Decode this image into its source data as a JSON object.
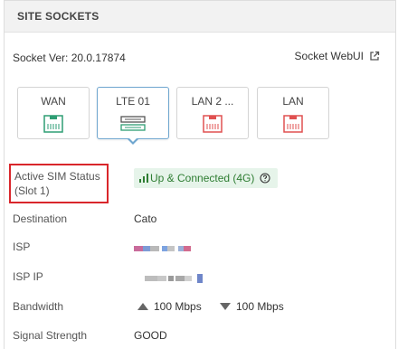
{
  "panel": {
    "title": "SITE SOCKETS"
  },
  "socket": {
    "version": "Socket Ver: 20.0.17874",
    "webui_label": "Socket WebUI"
  },
  "ports": [
    {
      "label": "WAN",
      "color": "#2e9e74"
    },
    {
      "label": "LTE 01",
      "color": "#444444"
    },
    {
      "label": "LAN 2 ...",
      "color": "#e05050"
    },
    {
      "label": "LAN",
      "color": "#e05050"
    }
  ],
  "details": {
    "sim_status_label": "Active SIM Status (Slot 1)",
    "sim_status_value": "Up & Connected (4G)",
    "destination_label": "Destination",
    "destination_value": "Cato",
    "isp_label": "ISP",
    "isp_ip_label": "ISP IP",
    "bandwidth_label": "Bandwidth",
    "upload": "100 Mbps",
    "download": "100 Mbps",
    "signal_label": "Signal Strength",
    "signal_value": "GOOD"
  },
  "colors": {
    "status_bg": "#e6f4ea",
    "status_text": "#2e7d32",
    "highlight": "#d9262b",
    "selected_border": "#6fa6cf"
  }
}
